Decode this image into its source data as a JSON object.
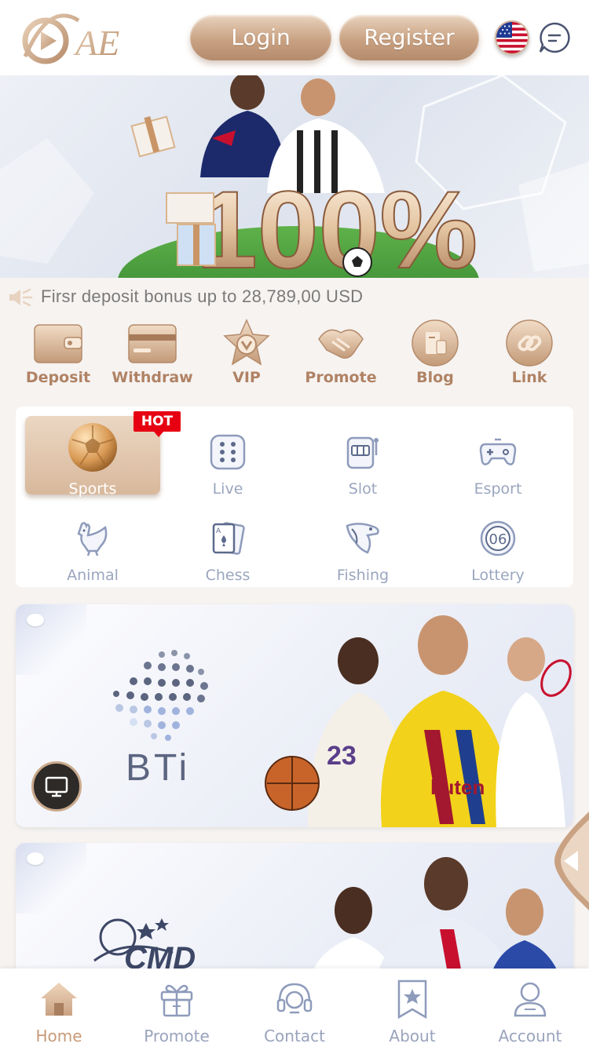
{
  "header": {
    "logo_text": "AE",
    "login_label": "Login",
    "register_label": "Register",
    "language_icon": "us-flag-icon",
    "chat_icon": "chat-bubble-icon"
  },
  "hero": {
    "promo_text": "100%"
  },
  "marquee": {
    "text": "Firsr deposit bonus up to 28,789,00 USD"
  },
  "quick_actions": [
    {
      "label": "Deposit",
      "icon": "wallet-icon"
    },
    {
      "label": "Withdraw",
      "icon": "card-icon"
    },
    {
      "label": "VIP",
      "icon": "vip-star-icon"
    },
    {
      "label": "Promote",
      "icon": "handshake-icon"
    },
    {
      "label": "Blog",
      "icon": "blog-icon"
    },
    {
      "label": "Link",
      "icon": "link-icon"
    }
  ],
  "categories": [
    {
      "label": "Sports",
      "icon": "soccer-ball-icon",
      "active": true,
      "badge": "HOT"
    },
    {
      "label": "Live",
      "icon": "dice-icon"
    },
    {
      "label": "Slot",
      "icon": "slot-machine-icon"
    },
    {
      "label": "Esport",
      "icon": "gamepad-icon"
    },
    {
      "label": "Animal",
      "icon": "rooster-icon"
    },
    {
      "label": "Chess",
      "icon": "playing-card-icon"
    },
    {
      "label": "Fishing",
      "icon": "fish-icon"
    },
    {
      "label": "Lottery",
      "icon": "lottery-ball-icon"
    }
  ],
  "lottery_number": "06",
  "games": [
    {
      "provider": "BTi"
    },
    {
      "provider": "CMD"
    }
  ],
  "bottom_nav": [
    {
      "label": "Home",
      "icon": "home-icon",
      "active": true
    },
    {
      "label": "Promote",
      "icon": "gift-icon"
    },
    {
      "label": "Contact",
      "icon": "headset-icon"
    },
    {
      "label": "About",
      "icon": "star-bookmark-icon"
    },
    {
      "label": "Account",
      "icon": "user-icon"
    }
  ],
  "colors": {
    "accent_gold": "#c9a283",
    "label_gold": "#b08264",
    "muted_blue": "#9aa6bf",
    "hot_red": "#e60012"
  }
}
